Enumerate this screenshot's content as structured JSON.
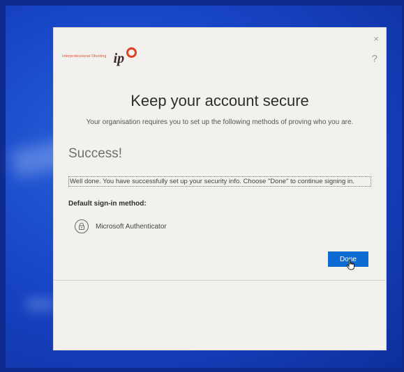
{
  "logo": {
    "text": "Interprofessional Obvoting",
    "mark": "ip"
  },
  "dialog": {
    "close_symbol": "×",
    "help_symbol": "?",
    "title": "Keep your account secure",
    "subtitle": "Your organisation requires you to set up the following methods of proving who you are.",
    "status_heading": "Success!",
    "message": "Well done. You have successfully set up your security info. Choose \"Done\" to continue signing in.",
    "default_method_label": "Default sign-in method:",
    "method": {
      "icon": "authenticator-lock-icon",
      "label": "Microsoft Authenticator"
    },
    "done_label": "Done"
  },
  "colors": {
    "accent": "#0b6bd3",
    "logo_red": "#e0401f",
    "dialog_bg": "#f2f1ee",
    "desktop_bg": "#1846c8"
  }
}
